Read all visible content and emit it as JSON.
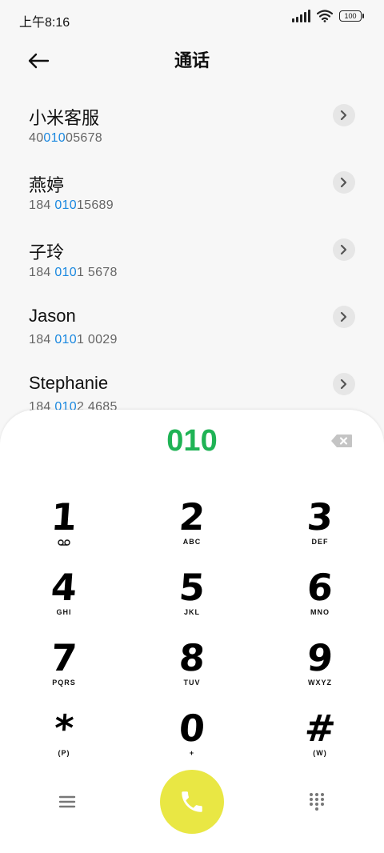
{
  "status_bar": {
    "time": "上午8:16",
    "battery": "100"
  },
  "header": {
    "title": "通话"
  },
  "contacts": [
    {
      "name": "小米客服",
      "number_pre": "40",
      "number_hl": "010",
      "number_post": "05678"
    },
    {
      "name": "燕婷",
      "number_pre": "184 ",
      "number_hl": "010",
      "number_post": "15689"
    },
    {
      "name": "子玲",
      "number_pre": "184 ",
      "number_hl": "010",
      "number_post": "1 5678"
    },
    {
      "name": "Jason",
      "number_pre": "184 ",
      "number_hl": "010",
      "number_post": "1 0029"
    },
    {
      "name": "Stephanie",
      "number_pre": "184 ",
      "number_hl": "010",
      "number_post": "2 4685"
    }
  ],
  "dialpad": {
    "input_value": "010",
    "keys": [
      {
        "digit": "1",
        "letters": ""
      },
      {
        "digit": "2",
        "letters": "ABC"
      },
      {
        "digit": "3",
        "letters": "DEF"
      },
      {
        "digit": "4",
        "letters": "GHI"
      },
      {
        "digit": "5",
        "letters": "JKL"
      },
      {
        "digit": "6",
        "letters": "MNO"
      },
      {
        "digit": "7",
        "letters": "PQRS"
      },
      {
        "digit": "8",
        "letters": "TUV"
      },
      {
        "digit": "9",
        "letters": "WXYZ"
      },
      {
        "digit": "*",
        "letters": "(P)"
      },
      {
        "digit": "0",
        "letters": "+"
      },
      {
        "digit": "#",
        "letters": "(W)"
      }
    ]
  },
  "colors": {
    "accent_green": "#1fb355",
    "highlight_blue": "#1a88e0",
    "call_button": "#e9e744"
  }
}
